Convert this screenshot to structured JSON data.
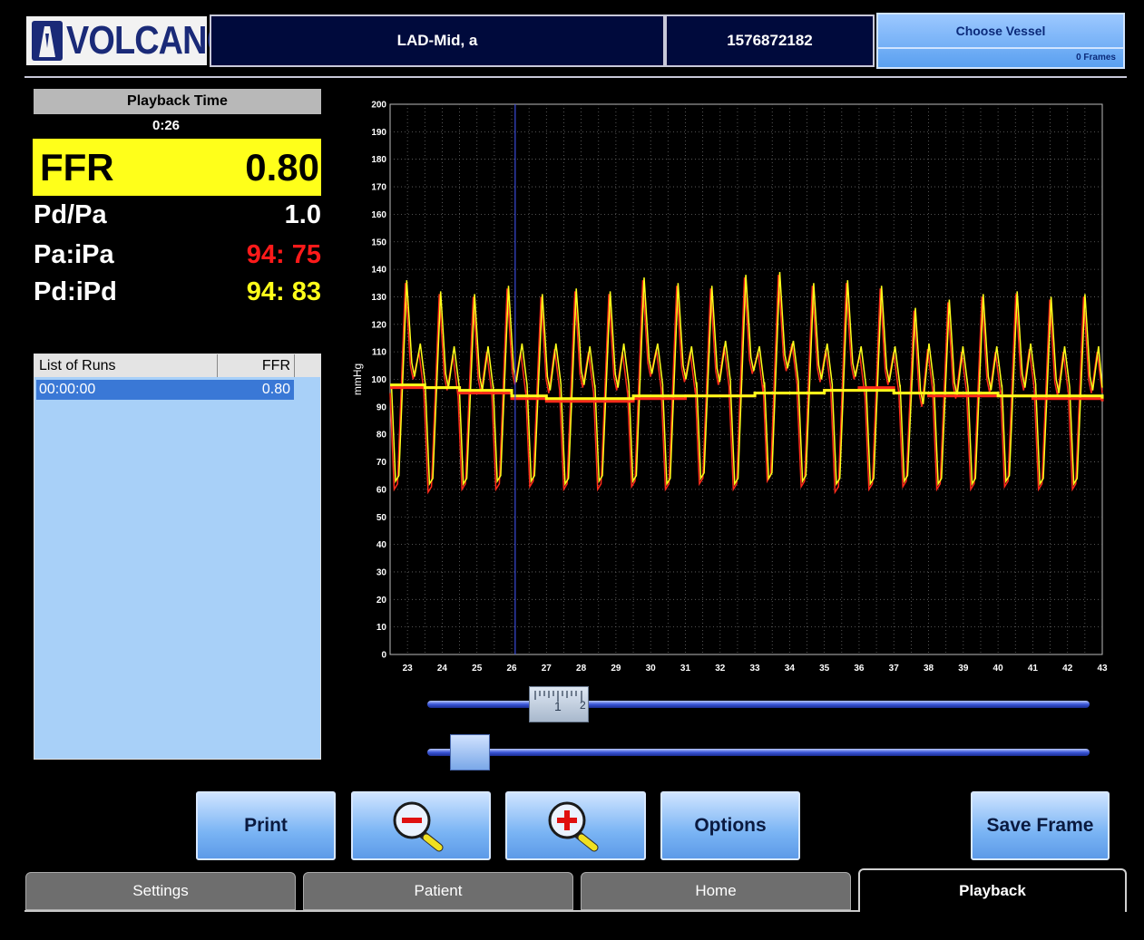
{
  "header": {
    "brand": "VOLCANO",
    "vessel": "LAD-Mid,  a",
    "patient_id": "1576872182",
    "choose_vessel_label": "Choose Vessel",
    "frames_label": "0 Frames"
  },
  "left_panel": {
    "playback_title": "Playback Time",
    "playback_time": "0:26",
    "ffr_label": "FFR",
    "ffr_value": "0.80",
    "pdpa_label": "Pd/Pa",
    "pdpa_value": "1.0",
    "pa_label": "Pa:iPa",
    "pa_value": "94: 75",
    "pd_label": "Pd:iPd",
    "pd_value": "94: 83",
    "runs_header": "List of Runs",
    "runs_ffr_header": "FFR",
    "runs": [
      {
        "time": "00:00:00",
        "ffr": "0.80"
      }
    ]
  },
  "colors": {
    "ffr_highlight": "#ffff1a",
    "pa_red": "#ff1a1a",
    "pd_yellow": "#ffff1a",
    "button_blue": "#7ab4f4"
  },
  "buttons": {
    "print": "Print",
    "zoom_out": "zoom-out-icon",
    "zoom_in": "zoom-in-icon",
    "options": "Options",
    "save_frame": "Save Frame"
  },
  "tabs": [
    {
      "label": "Settings",
      "active": false
    },
    {
      "label": "Patient",
      "active": false
    },
    {
      "label": "Home",
      "active": false
    },
    {
      "label": "Playback",
      "active": true
    }
  ],
  "chart_data": {
    "type": "line",
    "ylabel": "mmHg",
    "xlabel": "",
    "ylim": [
      0,
      200
    ],
    "xlim": [
      22.5,
      43
    ],
    "y_ticks": [
      0,
      10,
      20,
      30,
      40,
      50,
      60,
      70,
      80,
      90,
      100,
      110,
      120,
      130,
      140,
      150,
      160,
      170,
      180,
      190,
      200
    ],
    "x_ticks": [
      23,
      24,
      25,
      26,
      27,
      28,
      29,
      30,
      31,
      32,
      33,
      34,
      35,
      36,
      37,
      38,
      39,
      40,
      41,
      42,
      43
    ],
    "grid": true,
    "cursor_x": 26.1,
    "series": [
      {
        "color": "#ff2a1a",
        "kind": "pulsatile",
        "systolic": [
          135,
          131,
          130,
          133,
          130,
          132,
          131,
          136,
          134,
          133,
          137,
          138,
          134,
          135,
          133,
          125,
          128,
          130,
          131,
          129,
          130
        ],
        "diastolic": [
          60,
          59,
          60,
          60,
          61,
          60,
          60,
          61,
          60,
          62,
          60,
          63,
          61,
          59,
          60,
          61,
          60,
          60,
          61,
          60,
          60
        ]
      },
      {
        "color": "#ffff1a",
        "kind": "pulsatile",
        "systolic": [
          136,
          132,
          131,
          134,
          131,
          133,
          132,
          137,
          135,
          134,
          138,
          139,
          135,
          136,
          134,
          126,
          129,
          131,
          132,
          130,
          131
        ],
        "diastolic": [
          63,
          62,
          62,
          63,
          63,
          62,
          63,
          63,
          62,
          64,
          62,
          64,
          63,
          62,
          62,
          63,
          62,
          62,
          63,
          62,
          62
        ]
      },
      {
        "color": "#ff2a1a",
        "kind": "mean",
        "points": [
          [
            22.5,
            97
          ],
          [
            23.5,
            97
          ],
          [
            24.5,
            95
          ],
          [
            26,
            93
          ],
          [
            27,
            92
          ],
          [
            28,
            92
          ],
          [
            29.5,
            93
          ],
          [
            31,
            94
          ],
          [
            33,
            95
          ],
          [
            35,
            96
          ],
          [
            36,
            97
          ],
          [
            37,
            95
          ],
          [
            38,
            94
          ],
          [
            40,
            94
          ],
          [
            41,
            93
          ],
          [
            43,
            92
          ]
        ]
      },
      {
        "color": "#ffff1a",
        "kind": "mean",
        "points": [
          [
            22.5,
            98
          ],
          [
            23.5,
            97
          ],
          [
            24.5,
            96
          ],
          [
            26,
            94
          ],
          [
            27,
            93
          ],
          [
            28,
            93
          ],
          [
            29.5,
            94
          ],
          [
            31,
            94
          ],
          [
            33,
            95
          ],
          [
            35,
            96
          ],
          [
            36,
            96
          ],
          [
            37,
            95
          ],
          [
            38,
            95
          ],
          [
            40,
            94
          ],
          [
            41,
            94
          ],
          [
            43,
            93
          ]
        ]
      }
    ]
  }
}
